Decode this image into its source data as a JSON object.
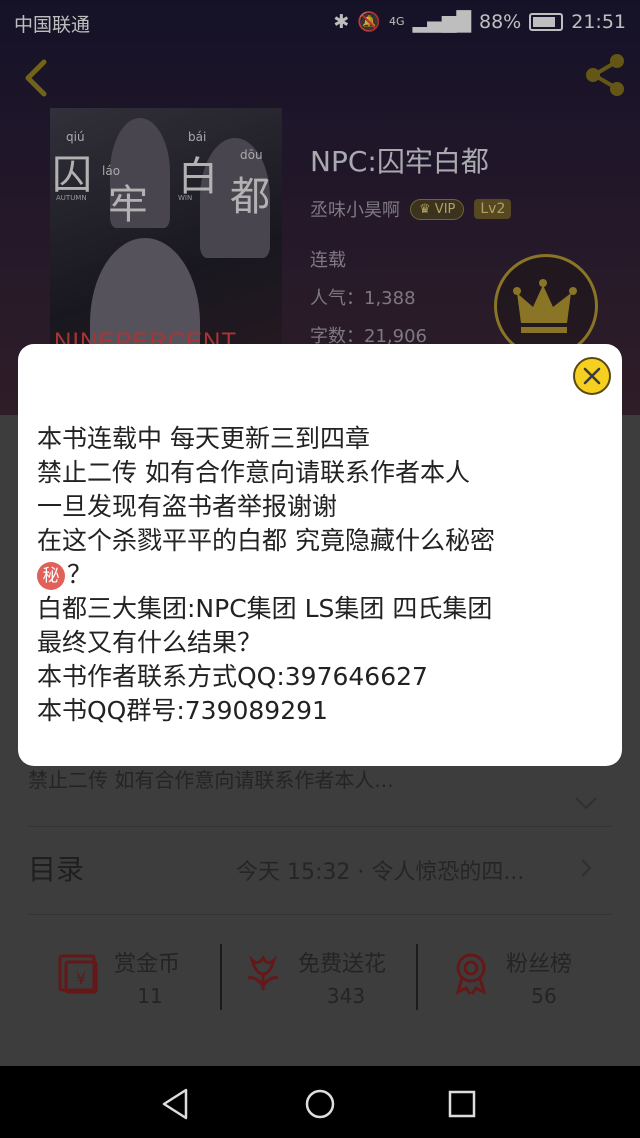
{
  "status_bar": {
    "carrier": "中国联通",
    "network": "4G",
    "battery": "88%",
    "time": "21:51"
  },
  "book": {
    "title": "NPC:囚牢白都",
    "author": "丞味小昊啊",
    "vip_label": "VIP",
    "level": "Lv2",
    "state": "连载",
    "popularity": "人气：1,388",
    "word_count": "字数：21,906",
    "cover": {
      "chars": [
        "囚",
        "牢",
        "白",
        "都"
      ],
      "pinyin": [
        "qiú",
        "láo",
        "bái",
        "dōu"
      ],
      "english": [
        "AUTUMN",
        "",
        "WIN",
        ""
      ],
      "brand": "NINEPERCENT"
    }
  },
  "intro_preview": "禁止二传   如有合作意向请联系作者本人...",
  "toc": {
    "label": "目录",
    "latest": "今天 15:32 · 令人惊恐的四..."
  },
  "stats": [
    {
      "label": "赏金币",
      "value": "11",
      "icon": "coin-envelope-icon"
    },
    {
      "label": "免费送花",
      "value": "343",
      "icon": "flower-icon"
    },
    {
      "label": "粉丝榜",
      "value": "56",
      "icon": "ribbon-medal-icon"
    }
  ],
  "dialog": {
    "lines": [
      "本书连载中   每天更新三到四章",
      "禁止二传   如有合作意向请联系作者本人",
      "一旦发现有盗书者举报谢谢",
      "在这个杀戮平平的白都    究竟隐藏什么秘密",
      "？",
      "白都三大集团:NPC集团    LS集团    四氏集团",
      "最终又有什么结果？",
      "本书作者联系方式QQ:397646627",
      "本书QQ群号:739089291"
    ],
    "secret_emoji_char": "秘"
  },
  "colors": {
    "accent_yellow": "#f5d020",
    "dialog_bg": "#ffffff",
    "icon_red": "#c0392b"
  }
}
